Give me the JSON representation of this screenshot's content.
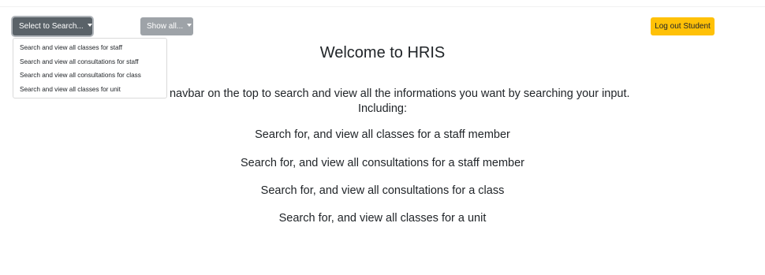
{
  "navbar": {
    "select_label": "Select to Search...",
    "show_label": "Show all...",
    "logout_label": "Log out Student"
  },
  "dropdown": {
    "items": [
      "Search and view all classes for staff",
      "Search and view all consultations for staff",
      "Search and view all consultations for class",
      "Search and view all classes for unit"
    ]
  },
  "main": {
    "title": "Welcome to HRIS",
    "intro_line1": "se the navbar on the top to search and view all the informations you want by searching your input.",
    "intro_line2": "Including:",
    "features": [
      "Search for, and view all classes for a staff member",
      "Search for, and view all consultations for a staff member",
      "Search for, and view all consultations for a class",
      "Search for, and view all classes for a unit"
    ]
  },
  "colors": {
    "select_button": "#5a6268",
    "show_button": "#9ea3a8",
    "logout_button": "#ffc107",
    "text": "#212529"
  }
}
